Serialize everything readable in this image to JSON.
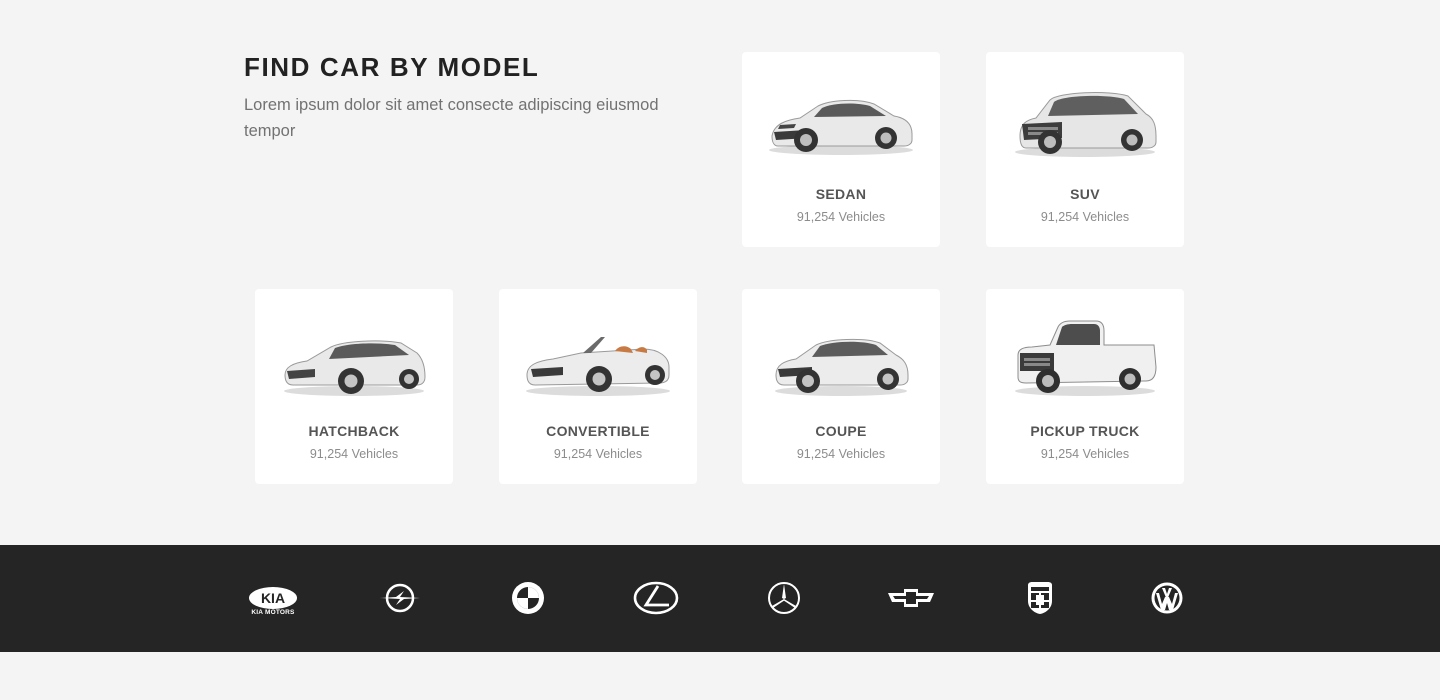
{
  "section": {
    "title": "FIND CAR BY MODEL",
    "description": "Lorem ipsum dolor sit amet consecte adipiscing eiusmod tempor"
  },
  "models": [
    {
      "name": "SEDAN",
      "count": "91,254 Vehicles",
      "icon": "sedan-car-image"
    },
    {
      "name": "SUV",
      "count": "91,254 Vehicles",
      "icon": "suv-car-image"
    },
    {
      "name": "HATCHBACK",
      "count": "91,254 Vehicles",
      "icon": "hatchback-car-image"
    },
    {
      "name": "CONVERTIBLE",
      "count": "91,254 Vehicles",
      "icon": "convertible-car-image"
    },
    {
      "name": "COUPE",
      "count": "91,254 Vehicles",
      "icon": "coupe-car-image"
    },
    {
      "name": "PICKUP TRUCK",
      "count": "91,254 Vehicles",
      "icon": "pickup-truck-image"
    }
  ],
  "brands": [
    {
      "name": "kia",
      "icon": "kia-logo",
      "wordmark": "KIA",
      "subtext": "KIA MOTORS"
    },
    {
      "name": "opel",
      "icon": "opel-logo"
    },
    {
      "name": "bmw",
      "icon": "bmw-logo"
    },
    {
      "name": "lexus",
      "icon": "lexus-logo"
    },
    {
      "name": "mercedes-benz",
      "icon": "mercedes-logo"
    },
    {
      "name": "chevrolet",
      "icon": "chevrolet-logo"
    },
    {
      "name": "porsche",
      "icon": "porsche-logo"
    },
    {
      "name": "volkswagen",
      "icon": "volkswagen-logo"
    }
  ],
  "colors": {
    "background": "#f4f4f4",
    "card": "#ffffff",
    "brand_bar": "#252525",
    "heading": "#222222",
    "muted_text": "#727272"
  }
}
